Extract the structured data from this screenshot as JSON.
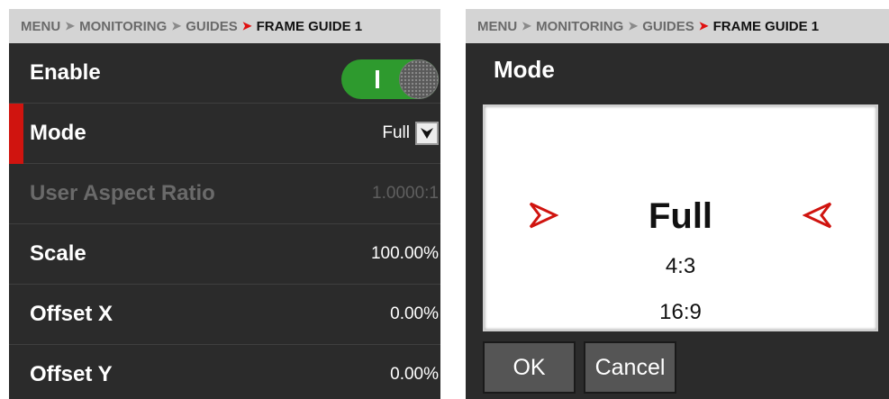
{
  "left": {
    "breadcrumb": [
      "MENU",
      "MONITORING",
      "GUIDES",
      "FRAME GUIDE 1"
    ],
    "rows": {
      "enable": {
        "label": "Enable",
        "on": true
      },
      "mode": {
        "label": "Mode",
        "value": "Full"
      },
      "user_aspect_ratio": {
        "label": "User Aspect Ratio",
        "value": "1.0000:1",
        "disabled": true
      },
      "scale": {
        "label": "Scale",
        "value": "100.00%"
      },
      "offset_x": {
        "label": "Offset X",
        "value": "0.00%"
      },
      "offset_y": {
        "label": "Offset Y",
        "value": "0.00%"
      }
    }
  },
  "right": {
    "breadcrumb": [
      "MENU",
      "MONITORING",
      "GUIDES",
      "FRAME GUIDE 1"
    ],
    "dialog_title": "Mode",
    "options": [
      "Full",
      "4:3",
      "16:9"
    ],
    "selected": "Full",
    "ok_label": "OK",
    "cancel_label": "Cancel"
  },
  "colors": {
    "accent_red": "#d0140f",
    "toggle_green": "#2e9a2e",
    "panel_bg": "#2b2b2b",
    "breadcrumb_bg": "#d4d4d4"
  },
  "icons": {
    "breadcrumb_separator": "chevron-right-icon",
    "current_separator": "red-chevron-right-icon",
    "dropdown": "dropdown-arrow-icon",
    "picker_markers": [
      "selection-arrow-left-icon",
      "selection-arrow-right-icon"
    ]
  }
}
